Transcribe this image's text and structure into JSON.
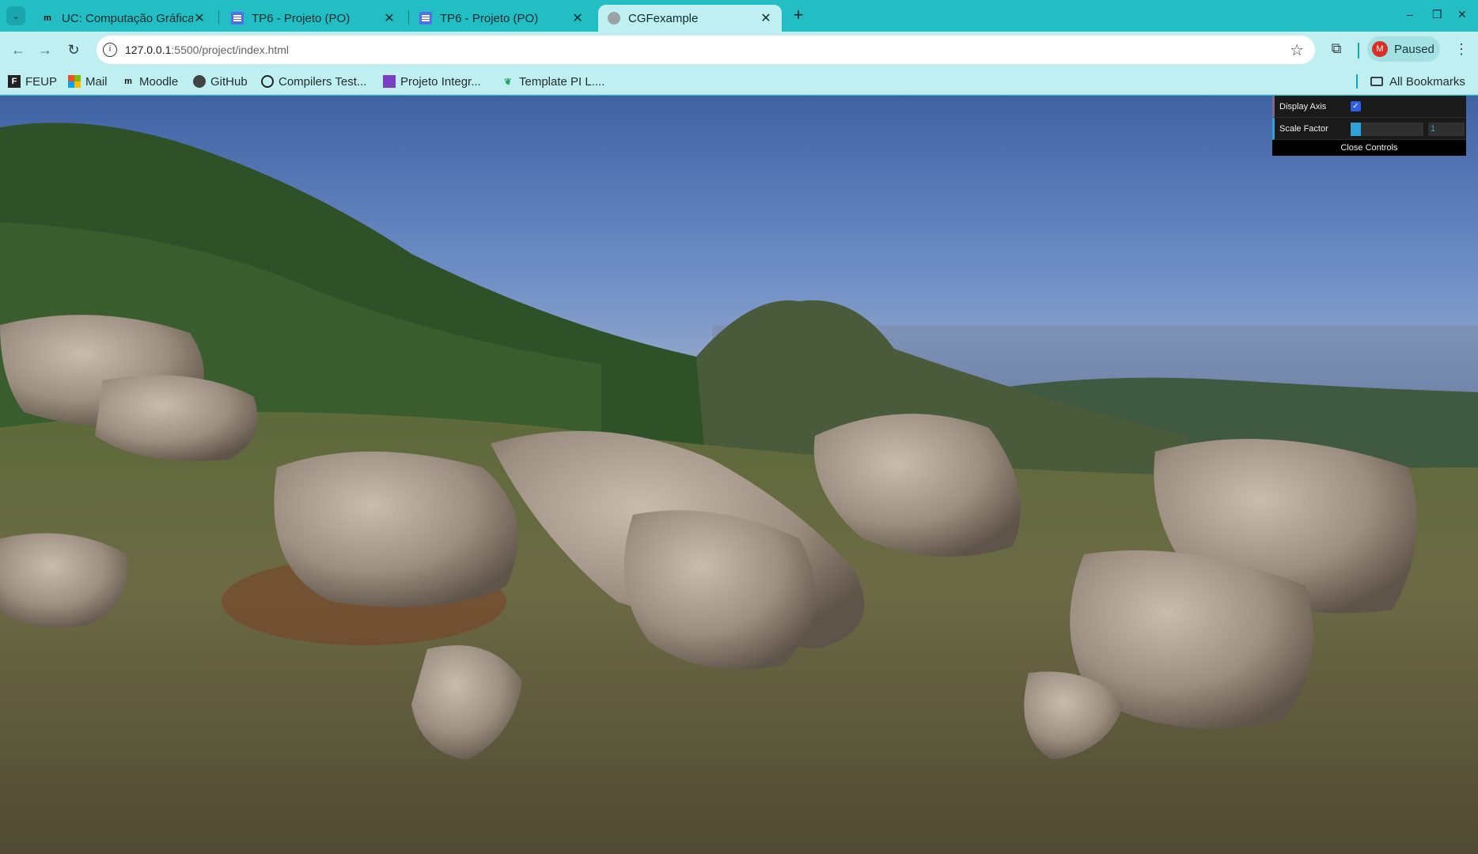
{
  "browser": {
    "tabs": [
      {
        "title": "UC: Computação Gráfica",
        "icon": "moodle-icon",
        "active": false
      },
      {
        "title": "TP6 - Projeto (PO)",
        "icon": "docs-icon",
        "active": false
      },
      {
        "title": "TP6 - Projeto (PO)",
        "icon": "docs-icon",
        "active": false
      },
      {
        "title": "CGFexample",
        "icon": "globe-icon",
        "active": true
      }
    ],
    "address": {
      "host": "127.0.0.1",
      "rest": ":5500/project/index.html"
    },
    "profile": {
      "initial": "M",
      "label": "Paused"
    },
    "bookmarks": [
      {
        "label": "FEUP",
        "icon": "feup-icon"
      },
      {
        "label": "Mail",
        "icon": "microsoft-icon"
      },
      {
        "label": "Moodle",
        "icon": "moodle-icon"
      },
      {
        "label": "GitHub",
        "icon": "github-icon"
      },
      {
        "label": "Compilers Test...",
        "icon": "compass-icon"
      },
      {
        "label": "Projeto Integr...",
        "icon": "project-icon"
      },
      {
        "label": "Template PI L....",
        "icon": "leaf-icon"
      }
    ],
    "all_bookmarks": "All Bookmarks"
  },
  "gui": {
    "display_axis": {
      "label": "Display Axis",
      "checked": true
    },
    "scale_factor": {
      "label": "Scale Factor",
      "value": "1",
      "fraction": 0.06
    },
    "close_label": "Close Controls"
  },
  "colors": {
    "chrome_frame": "#23bdc4",
    "chrome_toolbar": "#bfeff0",
    "gui_bg": "#1a1a1a",
    "gui_number": "#2fa1d6"
  }
}
